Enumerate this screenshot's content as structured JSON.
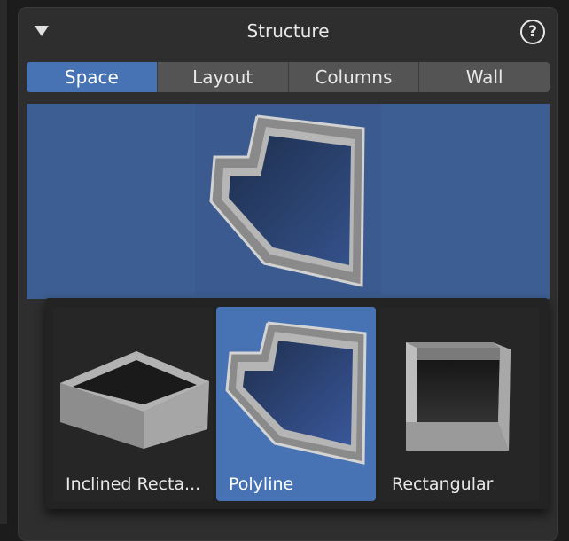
{
  "panel": {
    "title": "Structure",
    "help_icon": "question-circle-icon",
    "collapse_icon": "triangle-down-icon"
  },
  "tabs": [
    {
      "label": "Space",
      "active": true
    },
    {
      "label": "Layout",
      "active": false
    },
    {
      "label": "Columns",
      "active": false
    },
    {
      "label": "Wall",
      "active": false
    }
  ],
  "preview": {
    "shape": "polyline-room-icon"
  },
  "options": [
    {
      "label": "Inclined Recta...",
      "icon": "inclined-rectangle-room-icon",
      "selected": false
    },
    {
      "label": "Polyline",
      "icon": "polyline-room-icon",
      "selected": true
    },
    {
      "label": "Rectangular",
      "icon": "rectangular-room-icon",
      "selected": false
    }
  ],
  "colors": {
    "accent": "#4772b3",
    "preview_bg": "#3d5e92",
    "panel_bg": "#2e2e2e"
  }
}
